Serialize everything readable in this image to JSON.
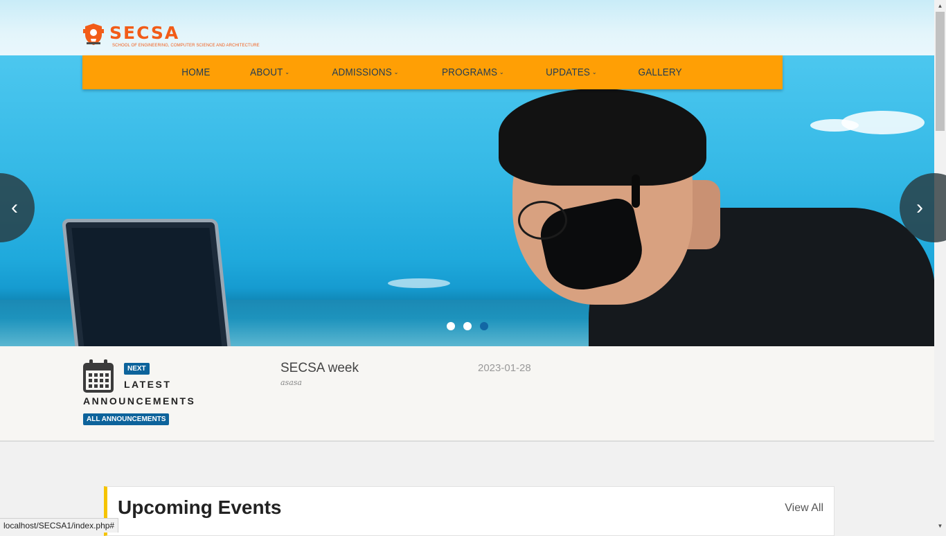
{
  "logo": {
    "title": "SECSA",
    "subtitle": "SCHOOL OF ENGINEERING, COMPUTER SCIENCE AND ARCHITECTURE"
  },
  "nav": [
    {
      "label": "HOME",
      "dropdown": false
    },
    {
      "label": "ABOUT",
      "dropdown": true
    },
    {
      "label": "ADMISSIONS",
      "dropdown": true
    },
    {
      "label": "PROGRAMS",
      "dropdown": true
    },
    {
      "label": "UPDATES",
      "dropdown": true
    },
    {
      "label": "GALLERY",
      "dropdown": false
    }
  ],
  "carousel": {
    "slides": 3,
    "active_slide": 3,
    "prev_icon": "chevron-left-icon",
    "next_icon": "chevron-right-icon"
  },
  "announcements": {
    "badge_next": "NEXT",
    "heading_line1": "LATEST",
    "heading_line2": "ANNOUNCEMENTS",
    "all_button": "ALL ANNOUNCEMENTS",
    "item": {
      "title": "SECSA week",
      "description": "asasa",
      "date": "2023-01-28"
    }
  },
  "events": {
    "title": "Upcoming Events",
    "view_all": "View All"
  },
  "status_url": "localhost/SECSA1/index.php#",
  "colors": {
    "nav_bg": "#ff9f05",
    "brand": "#f25c18",
    "badge": "#0d639b",
    "accent": "#f5c400"
  }
}
